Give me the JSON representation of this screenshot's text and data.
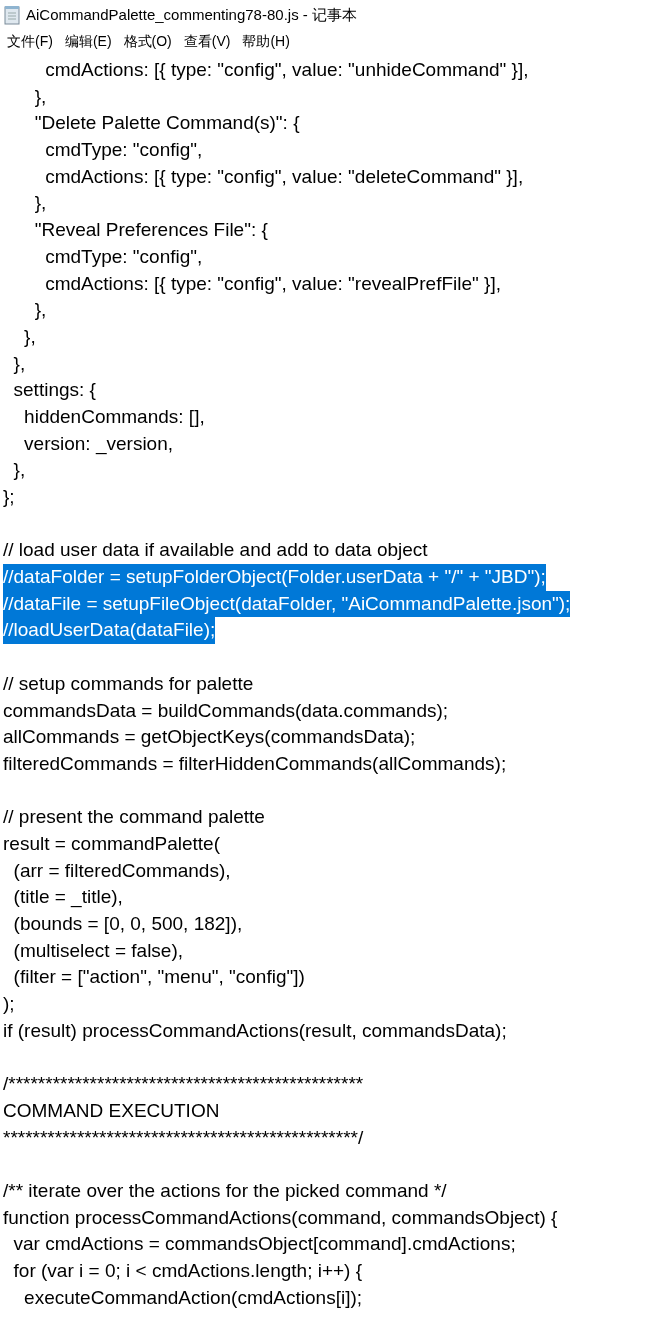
{
  "window": {
    "title": "AiCommandPalette_commenting78-80.js - 记事本"
  },
  "menu": [
    "文件(F)",
    "编辑(E)",
    "格式(O)",
    "查看(V)",
    "帮助(H)"
  ],
  "lines": [
    {
      "kind": "code",
      "text": "        cmdActions: [{ type: \"config\", value: \"unhideCommand\" }],",
      "selected": false
    },
    {
      "kind": "code",
      "text": "      },",
      "selected": false
    },
    {
      "kind": "code",
      "text": "      \"Delete Palette Command(s)\": {",
      "selected": false
    },
    {
      "kind": "code",
      "text": "        cmdType: \"config\",",
      "selected": false
    },
    {
      "kind": "code",
      "text": "        cmdActions: [{ type: \"config\", value: \"deleteCommand\" }],",
      "selected": false
    },
    {
      "kind": "code",
      "text": "      },",
      "selected": false
    },
    {
      "kind": "code",
      "text": "      \"Reveal Preferences File\": {",
      "selected": false
    },
    {
      "kind": "code",
      "text": "        cmdType: \"config\",",
      "selected": false
    },
    {
      "kind": "code",
      "text": "        cmdActions: [{ type: \"config\", value: \"revealPrefFile\" }],",
      "selected": false
    },
    {
      "kind": "code",
      "text": "      },",
      "selected": false
    },
    {
      "kind": "code",
      "text": "    },",
      "selected": false
    },
    {
      "kind": "code",
      "text": "  },",
      "selected": false
    },
    {
      "kind": "code",
      "text": "  settings: {",
      "selected": false
    },
    {
      "kind": "code",
      "text": "    hiddenCommands: [],",
      "selected": false
    },
    {
      "kind": "code",
      "text": "    version: _version,",
      "selected": false
    },
    {
      "kind": "code",
      "text": "  },",
      "selected": false
    },
    {
      "kind": "code",
      "text": "};",
      "selected": false
    },
    {
      "kind": "blank"
    },
    {
      "kind": "code",
      "text": "// load user data if available and add to data object",
      "selected": false
    },
    {
      "kind": "code",
      "text": "//dataFolder = setupFolderObject(Folder.userData + \"/\" + \"JBD\");",
      "selected": true
    },
    {
      "kind": "code",
      "text": "//dataFile = setupFileObject(dataFolder, \"AiCommandPalette.json\");",
      "selected": true
    },
    {
      "kind": "code",
      "text": "//loadUserData(dataFile);",
      "selected": true
    },
    {
      "kind": "blank"
    },
    {
      "kind": "code",
      "text": "// setup commands for palette",
      "selected": false
    },
    {
      "kind": "code",
      "text": "commandsData = buildCommands(data.commands);",
      "selected": false
    },
    {
      "kind": "code",
      "text": "allCommands = getObjectKeys(commandsData);",
      "selected": false
    },
    {
      "kind": "code",
      "text": "filteredCommands = filterHiddenCommands(allCommands);",
      "selected": false
    },
    {
      "kind": "blank"
    },
    {
      "kind": "code",
      "text": "// present the command palette",
      "selected": false
    },
    {
      "kind": "code",
      "text": "result = commandPalette(",
      "selected": false
    },
    {
      "kind": "code",
      "text": "  (arr = filteredCommands),",
      "selected": false
    },
    {
      "kind": "code",
      "text": "  (title = _title),",
      "selected": false
    },
    {
      "kind": "code",
      "text": "  (bounds = [0, 0, 500, 182]),",
      "selected": false
    },
    {
      "kind": "code",
      "text": "  (multiselect = false),",
      "selected": false
    },
    {
      "kind": "code",
      "text": "  (filter = [\"action\", \"menu\", \"config\"])",
      "selected": false
    },
    {
      "kind": "code",
      "text": ");",
      "selected": false
    },
    {
      "kind": "code",
      "text": "if (result) processCommandActions(result, commandsData);",
      "selected": false
    },
    {
      "kind": "blank"
    },
    {
      "kind": "code",
      "text": "/************************************************",
      "selected": false
    },
    {
      "kind": "code",
      "text": "COMMAND EXECUTION",
      "selected": false
    },
    {
      "kind": "code",
      "text": "************************************************/",
      "selected": false
    },
    {
      "kind": "blank"
    },
    {
      "kind": "code",
      "text": "/** iterate over the actions for the picked command */",
      "selected": false
    },
    {
      "kind": "code",
      "text": "function processCommandActions(command, commandsObject) {",
      "selected": false
    },
    {
      "kind": "code",
      "text": "  var cmdActions = commandsObject[command].cmdActions;",
      "selected": false
    },
    {
      "kind": "code",
      "text": "  for (var i = 0; i < cmdActions.length; i++) {",
      "selected": false
    },
    {
      "kind": "code",
      "text": "    executeCommandAction(cmdActions[i]);",
      "selected": false
    }
  ]
}
